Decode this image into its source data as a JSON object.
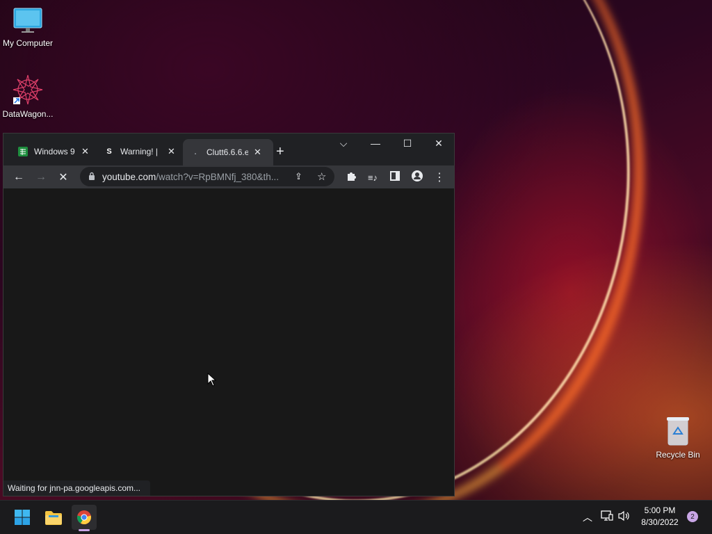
{
  "desktop": {
    "icons": [
      {
        "label": "My Computer"
      },
      {
        "label": "DataWagon..."
      },
      {
        "label": "Recycle Bin"
      }
    ]
  },
  "browser": {
    "tabs": [
      {
        "title": "Windows 9",
        "icon": "sheets-icon",
        "active": false
      },
      {
        "title": "Warning! |",
        "icon": "s-icon",
        "active": false
      },
      {
        "title": "Clutt6.6.6.e",
        "icon": "loading-icon",
        "active": true
      }
    ],
    "new_tab": "+",
    "url_domain": "youtube.com",
    "url_rest": "/watch?v=RpBMNfj_380&th...",
    "status_text": "Waiting for jnn-pa.googleapis.com..."
  },
  "taskbar": {
    "time": "5:00 PM",
    "date": "8/30/2022",
    "notifications": "2"
  },
  "colors": {
    "tab_active": "#35363a",
    "content_bg": "#181818",
    "taskbar_bg": "#1b1b1d"
  }
}
